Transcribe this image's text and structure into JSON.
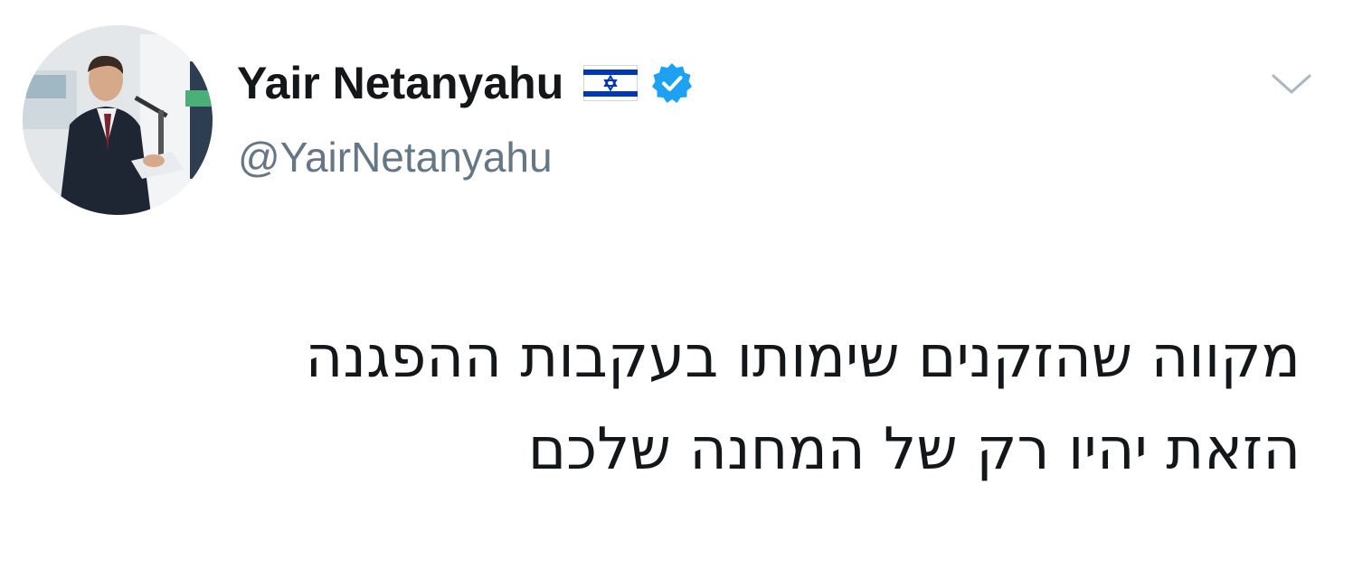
{
  "tweet": {
    "author": {
      "display_name": "Yair Netanyahu",
      "handle": "@YairNetanyahu"
    },
    "text_lines": [
      "מקווה שהזקנים שימותו בעקבות ההפגנה",
      "הזאת יהיו רק של המחנה שלכם"
    ],
    "icons": {
      "flag": "israel-flag-icon",
      "verified": "verified-badge-icon",
      "menu": "chevron-down-icon"
    },
    "colors": {
      "verified": "#1da1f2",
      "handle": "#657786",
      "text": "#14171a",
      "flag_blue": "#0038b8"
    }
  }
}
